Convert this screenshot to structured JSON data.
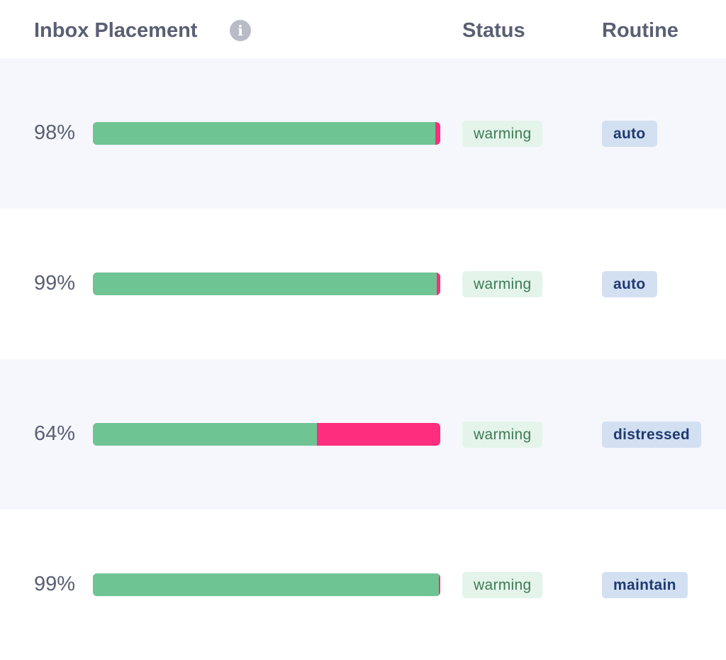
{
  "header": {
    "inbox_placement": "Inbox Placement",
    "info_glyph": "i",
    "status": "Status",
    "routine": "Routine"
  },
  "colors": {
    "inbox": "#6fc494",
    "spam": "#ff2d7d",
    "status_bg": "#e4f4ea",
    "routine_bg": "#d3e0f2"
  },
  "rows": [
    {
      "percent_label": "98%",
      "inbox_fraction": 0.985,
      "status": "warming",
      "routine": "auto"
    },
    {
      "percent_label": "99%",
      "inbox_fraction": 0.99,
      "status": "warming",
      "routine": "auto"
    },
    {
      "percent_label": "64%",
      "inbox_fraction": 0.645,
      "status": "warming",
      "routine": "distressed"
    },
    {
      "percent_label": "99%",
      "inbox_fraction": 0.995,
      "status": "warming",
      "routine": "maintain"
    }
  ]
}
